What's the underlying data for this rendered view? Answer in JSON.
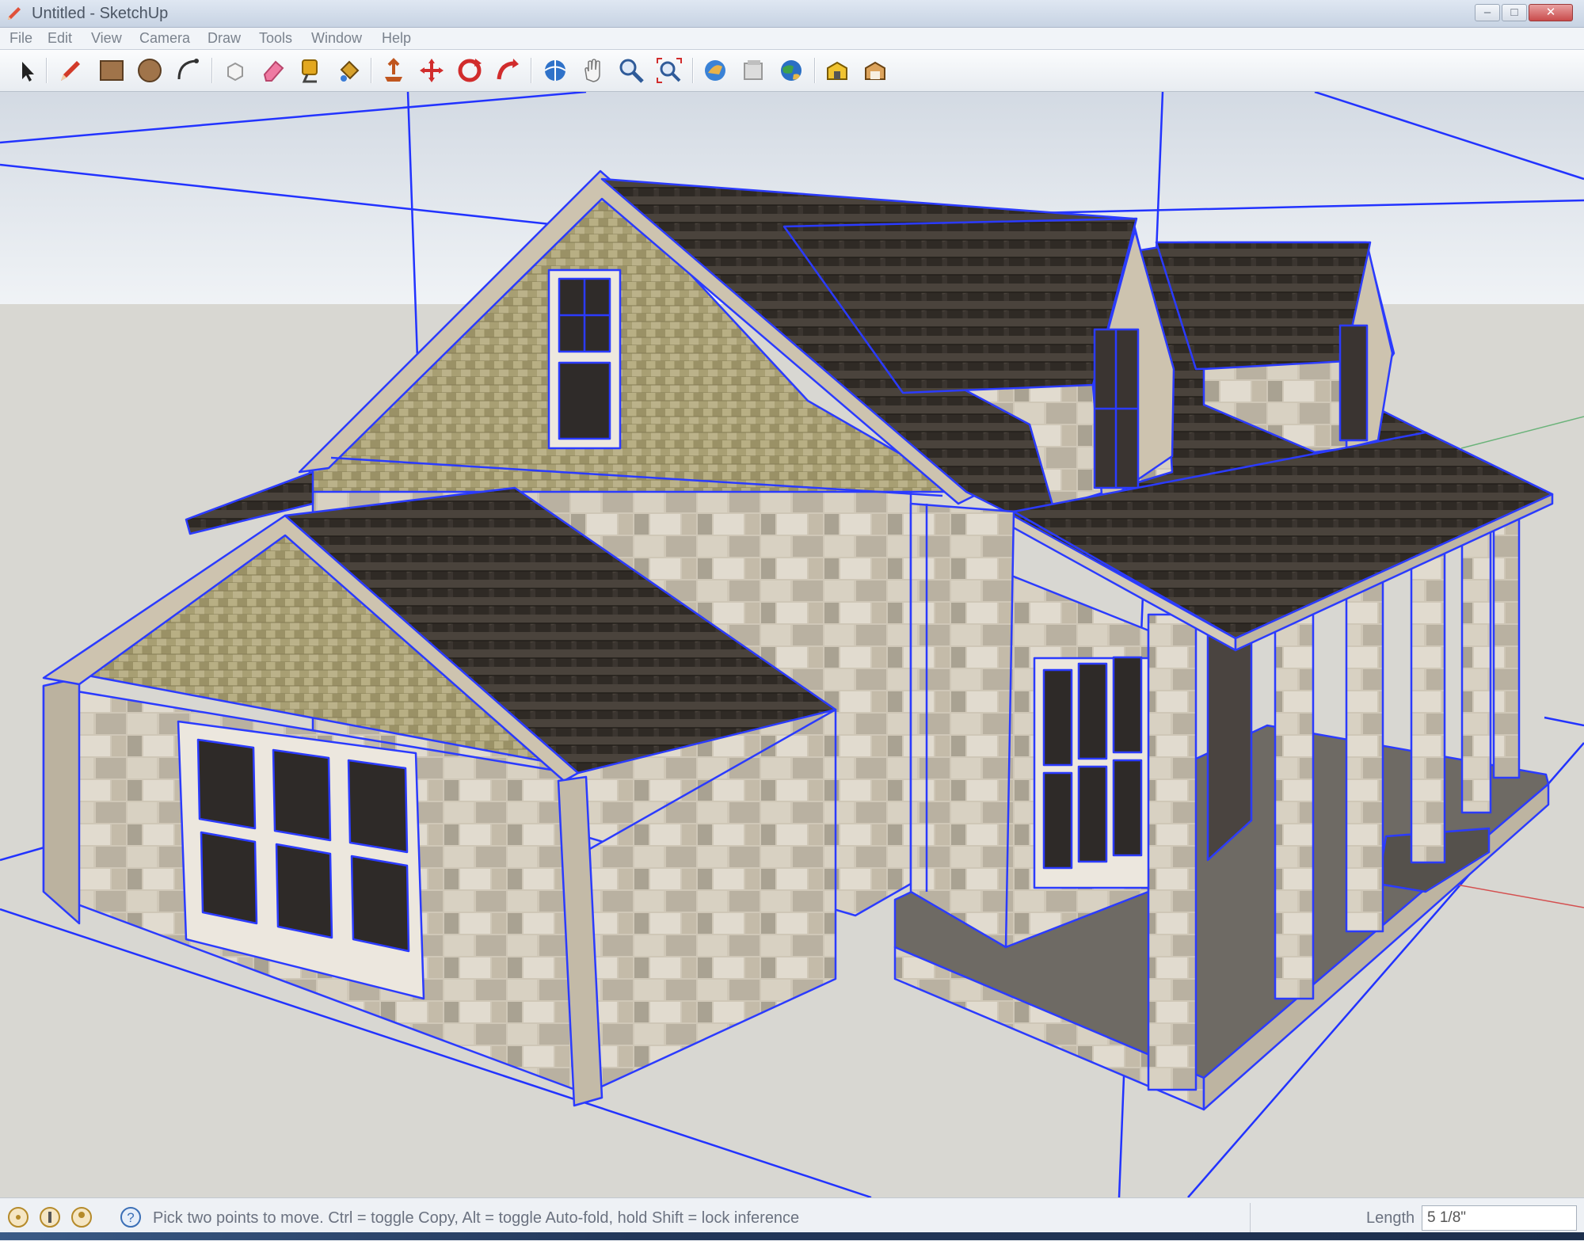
{
  "window": {
    "title": "Untitled - SketchUp",
    "app_icon": "sketchup-pencil-icon",
    "controls": [
      {
        "name": "minimize",
        "glyph": "–"
      },
      {
        "name": "maximize",
        "glyph": "□"
      },
      {
        "name": "close",
        "glyph": "✕"
      }
    ]
  },
  "menu": [
    "File",
    "Edit",
    "View",
    "Camera",
    "Draw",
    "Tools",
    "Window",
    "Help"
  ],
  "toolbar": {
    "tools": [
      {
        "name": "select",
        "icon": "arrow-cursor-icon"
      },
      {
        "name": "line",
        "icon": "pencil-icon"
      },
      {
        "name": "rectangle",
        "icon": "rectangle-icon"
      },
      {
        "name": "circle",
        "icon": "circle-icon"
      },
      {
        "name": "arc",
        "icon": "arc-icon"
      },
      {
        "name": "make-component",
        "icon": "component-icon"
      },
      {
        "name": "eraser",
        "icon": "eraser-icon"
      },
      {
        "name": "tape-measure",
        "icon": "tape-measure-icon"
      },
      {
        "name": "paint-bucket",
        "icon": "paint-bucket-icon"
      },
      {
        "name": "push-pull",
        "icon": "push-pull-icon"
      },
      {
        "name": "move",
        "icon": "move-icon"
      },
      {
        "name": "rotate",
        "icon": "rotate-icon"
      },
      {
        "name": "follow-me",
        "icon": "follow-me-icon"
      },
      {
        "name": "orbit",
        "icon": "orbit-icon"
      },
      {
        "name": "pan",
        "icon": "pan-hand-icon"
      },
      {
        "name": "zoom",
        "icon": "zoom-icon"
      },
      {
        "name": "zoom-extents",
        "icon": "zoom-extents-icon"
      },
      {
        "name": "get-models",
        "icon": "get-models-icon"
      },
      {
        "name": "share-model",
        "icon": "share-model-icon"
      },
      {
        "name": "google-earth",
        "icon": "google-earth-icon"
      },
      {
        "name": "extension-warehouse",
        "icon": "extension-warehouse-icon"
      },
      {
        "name": "3d-warehouse",
        "icon": "warehouse-icon"
      }
    ]
  },
  "status": {
    "message": "Pick two points to move.  Ctrl = toggle Copy, Alt = toggle Auto-fold, hold Shift = lock inference",
    "vcb_label": "Length",
    "vcb_value": "5 1/8\"",
    "icons": [
      "geo-location-icon",
      "credits-icon",
      "user-icon",
      "help-icon"
    ]
  },
  "colors": {
    "accent_selection": "#2233ff",
    "roof": "#3b3530",
    "stone_wall": "#c8bfae",
    "shingle_siding": "#a39a6f",
    "sky": "#e6ebf1",
    "ground": "#d7d6d1"
  }
}
